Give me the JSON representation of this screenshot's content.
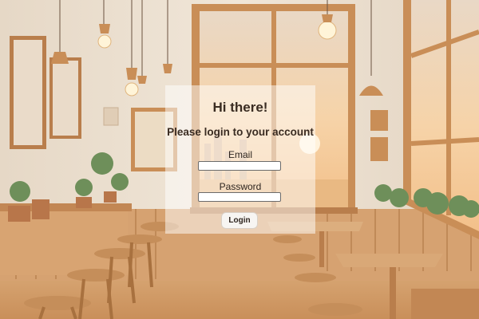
{
  "login": {
    "greeting": "Hi there!",
    "subtitle": "Please login to your account",
    "email_label": "Email",
    "email_value": "",
    "password_label": "Password",
    "password_value": "",
    "submit_label": "Login"
  },
  "colors": {
    "wall": "#efe4d4",
    "wood": "#d9a877",
    "window_frame": "#c98e57",
    "sky": "#f4cfa4",
    "panel_overlay": "#ffffff",
    "text": "#3a2c22"
  }
}
